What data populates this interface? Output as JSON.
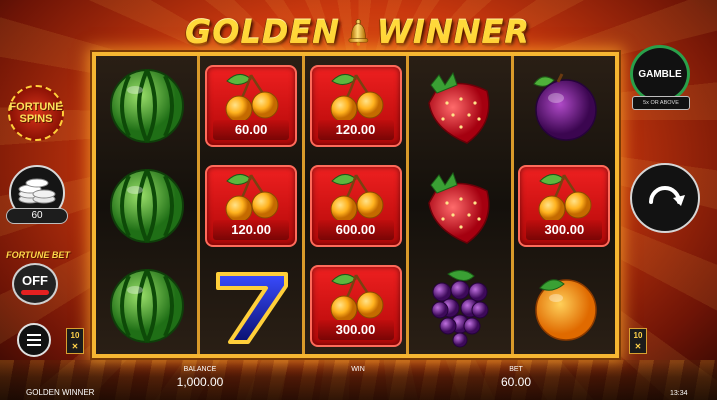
{
  "logo": {
    "word1": "GOLDEN",
    "word2": "WINNER"
  },
  "left_panel": {
    "fortune_spins_line1": "FORTUNE",
    "fortune_spins_line2": "SPINS",
    "coin_value": "60",
    "fortune_bet_label": "FORTUNE BET",
    "fortune_bet_state": "OFF"
  },
  "right_panel": {
    "gamble_label": "GAMBLE",
    "gamble_sub": "5x OR ABOVE"
  },
  "reels": [
    [
      {
        "symbol": "watermelon"
      },
      {
        "symbol": "watermelon"
      },
      {
        "symbol": "watermelon"
      }
    ],
    [
      {
        "symbol": "cherry",
        "value": "60.00"
      },
      {
        "symbol": "cherry",
        "value": "120.00"
      },
      {
        "symbol": "seven"
      }
    ],
    [
      {
        "symbol": "cherry",
        "value": "120.00"
      },
      {
        "symbol": "cherry",
        "value": "600.00"
      },
      {
        "symbol": "cherry",
        "value": "300.00"
      }
    ],
    [
      {
        "symbol": "strawberry"
      },
      {
        "symbol": "strawberry"
      },
      {
        "symbol": "grapes"
      }
    ],
    [
      {
        "symbol": "plum"
      },
      {
        "symbol": "cherry",
        "value": "300.00"
      },
      {
        "symbol": "orange"
      }
    ]
  ],
  "reel_badges": {
    "left": "10",
    "right": "10"
  },
  "bottom": {
    "game_name": "GOLDEN WINNER",
    "balance_label": "BALANCE",
    "balance_value": "1,000.00",
    "win_label": "WIN",
    "bet_label": "BET",
    "bet_value": "60.00",
    "clock": "13:34"
  },
  "colors": {
    "frame_gold": "#f6b632",
    "cherry_red": "#d51414",
    "gamble_green": "#29a04a"
  }
}
